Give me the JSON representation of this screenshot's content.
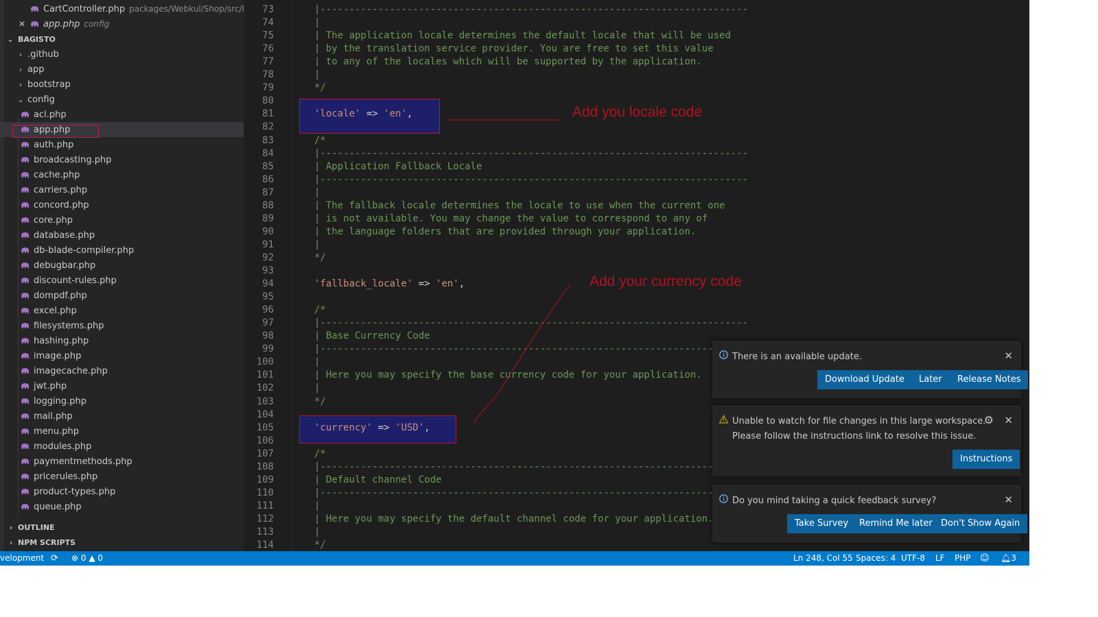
{
  "open_editors": [
    {
      "name": "CartController.php",
      "path": "packages/Webkul/Shop/src/H..."
    },
    {
      "name": "app.php",
      "path": "config",
      "close_icon": "close-icon"
    }
  ],
  "explorer": {
    "root": "BAGISTO",
    "folders": [
      ".github",
      "app",
      "bootstrap"
    ],
    "open_folder": "config",
    "files": [
      "acl.php",
      "app.php",
      "auth.php",
      "broadcasting.php",
      "cache.php",
      "carriers.php",
      "concord.php",
      "core.php",
      "database.php",
      "db-blade-compiler.php",
      "debugbar.php",
      "discount-rules.php",
      "dompdf.php",
      "excel.php",
      "filesystems.php",
      "hashing.php",
      "image.php",
      "imagecache.php",
      "jwt.php",
      "logging.php",
      "mail.php",
      "menu.php",
      "modules.php",
      "paymentmethods.php",
      "pricerules.php",
      "product-types.php",
      "queue.php"
    ],
    "selected_file": "app.php"
  },
  "panels": {
    "outline": "OUTLINE",
    "npm_scripts": "NPM SCRIPTS"
  },
  "editor": {
    "lines": [
      {
        "n": "73",
        "t": "|--------------------------------------------------------------------------",
        "k": "c"
      },
      {
        "n": "74",
        "t": "|",
        "k": "c"
      },
      {
        "n": "75",
        "t": "| The application locale determines the default locale that will be used",
        "k": "c"
      },
      {
        "n": "76",
        "t": "| by the translation service provider. You are free to set this value",
        "k": "c"
      },
      {
        "n": "77",
        "t": "| to any of the locales which will be supported by the application.",
        "k": "c"
      },
      {
        "n": "78",
        "t": "|",
        "k": "c"
      },
      {
        "n": "79",
        "t": "*/",
        "k": "c"
      },
      {
        "n": "80",
        "t": "",
        "k": "c"
      },
      {
        "n": "81",
        "key": "'locale'",
        "op": " => ",
        "val": "'en'",
        "end": ",",
        "k": "s"
      },
      {
        "n": "82",
        "t": "",
        "k": "c"
      },
      {
        "n": "83",
        "t": "/*",
        "k": "c"
      },
      {
        "n": "84",
        "t": "|--------------------------------------------------------------------------",
        "k": "c"
      },
      {
        "n": "85",
        "t": "| Application Fallback Locale",
        "k": "c"
      },
      {
        "n": "86",
        "t": "|--------------------------------------------------------------------------",
        "k": "c"
      },
      {
        "n": "87",
        "t": "|",
        "k": "c"
      },
      {
        "n": "88",
        "t": "| The fallback locale determines the locale to use when the current one",
        "k": "c"
      },
      {
        "n": "89",
        "t": "| is not available. You may change the value to correspond to any of",
        "k": "c"
      },
      {
        "n": "90",
        "t": "| the language folders that are provided through your application.",
        "k": "c"
      },
      {
        "n": "91",
        "t": "|",
        "k": "c"
      },
      {
        "n": "92",
        "t": "*/",
        "k": "c"
      },
      {
        "n": "93",
        "t": "",
        "k": "c"
      },
      {
        "n": "94",
        "key": "'fallback_locale'",
        "op": " => ",
        "val": "'en'",
        "end": ",",
        "k": "s"
      },
      {
        "n": "95",
        "t": "",
        "k": "c"
      },
      {
        "n": "96",
        "t": "/*",
        "k": "c"
      },
      {
        "n": "97",
        "t": "|--------------------------------------------------------------------------",
        "k": "c"
      },
      {
        "n": "98",
        "t": "| Base Currency Code",
        "k": "c"
      },
      {
        "n": "99",
        "t": "|--------------------------------------------------------------------------",
        "k": "c"
      },
      {
        "n": "100",
        "t": "|",
        "k": "c"
      },
      {
        "n": "101",
        "t": "| Here you may specify the base currency code for your application.",
        "k": "c"
      },
      {
        "n": "102",
        "t": "|",
        "k": "c"
      },
      {
        "n": "103",
        "t": "*/",
        "k": "c"
      },
      {
        "n": "104",
        "t": "",
        "k": "c"
      },
      {
        "n": "105",
        "key": "'currency'",
        "op": " => ",
        "val": "'USD'",
        "end": ",",
        "k": "s"
      },
      {
        "n": "106",
        "t": "",
        "k": "c"
      },
      {
        "n": "107",
        "t": "/*",
        "k": "c"
      },
      {
        "n": "108",
        "t": "|--------------------------------------------------------------------------",
        "k": "c"
      },
      {
        "n": "109",
        "t": "| Default channel Code",
        "k": "c"
      },
      {
        "n": "110",
        "t": "|--------------------------------------------------------------------------",
        "k": "c"
      },
      {
        "n": "111",
        "t": "|",
        "k": "c"
      },
      {
        "n": "112",
        "t": "| Here you may specify the default channel code for your application.",
        "k": "c"
      },
      {
        "n": "113",
        "t": "|",
        "k": "c"
      },
      {
        "n": "114",
        "t": "*/",
        "k": "c"
      }
    ]
  },
  "annotations": {
    "locale": "Add you locale code",
    "currency": "Add your currency code"
  },
  "notifications": {
    "update": {
      "message": "There is an available update.",
      "buttons": [
        "Download Update",
        "Later",
        "Release Notes"
      ]
    },
    "watch": {
      "line1": "Unable to watch for file changes in this large workspace.",
      "line2": "Please follow the instructions link to resolve this issue.",
      "button": "Instructions"
    },
    "survey": {
      "message": "Do you mind taking a quick feedback survey?",
      "buttons": [
        "Take Survey",
        "Remind Me later",
        "Don't Show Again"
      ]
    }
  },
  "statusbar": {
    "branch": "velopment",
    "errors": "0",
    "warnings": "0",
    "position": "Ln 248, Col 55",
    "spaces": "Spaces: 4",
    "encoding": "UTF-8",
    "eol": "LF",
    "language": "PHP",
    "bell_count": "3"
  },
  "colors": {
    "accent": "#007acc",
    "button": "#0e639c",
    "annotation": "#b3121f",
    "highlight_box": "#1d1f6b"
  }
}
